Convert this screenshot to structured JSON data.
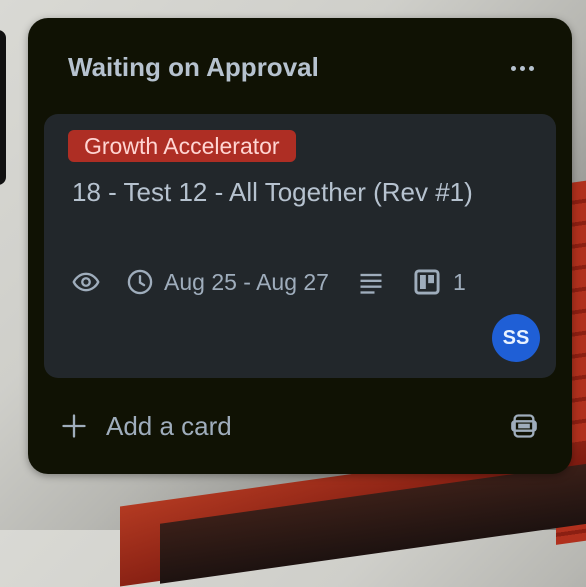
{
  "list": {
    "title": "Waiting on Approval",
    "more_icon": "ellipsis-icon"
  },
  "card": {
    "label": "Growth Accelerator",
    "label_color": "#ae2e24",
    "title": "18 - Test 12 - All Together (Rev #1)",
    "badges": {
      "watch_icon": "eye-icon",
      "dates": "Aug 25 - Aug 27",
      "description_icon": "description-icon",
      "board_count": "1"
    },
    "member": {
      "initials": "SS",
      "color": "#1f5fd6"
    }
  },
  "footer": {
    "add_card": "Add a card",
    "template_icon": "card-template-icon"
  }
}
